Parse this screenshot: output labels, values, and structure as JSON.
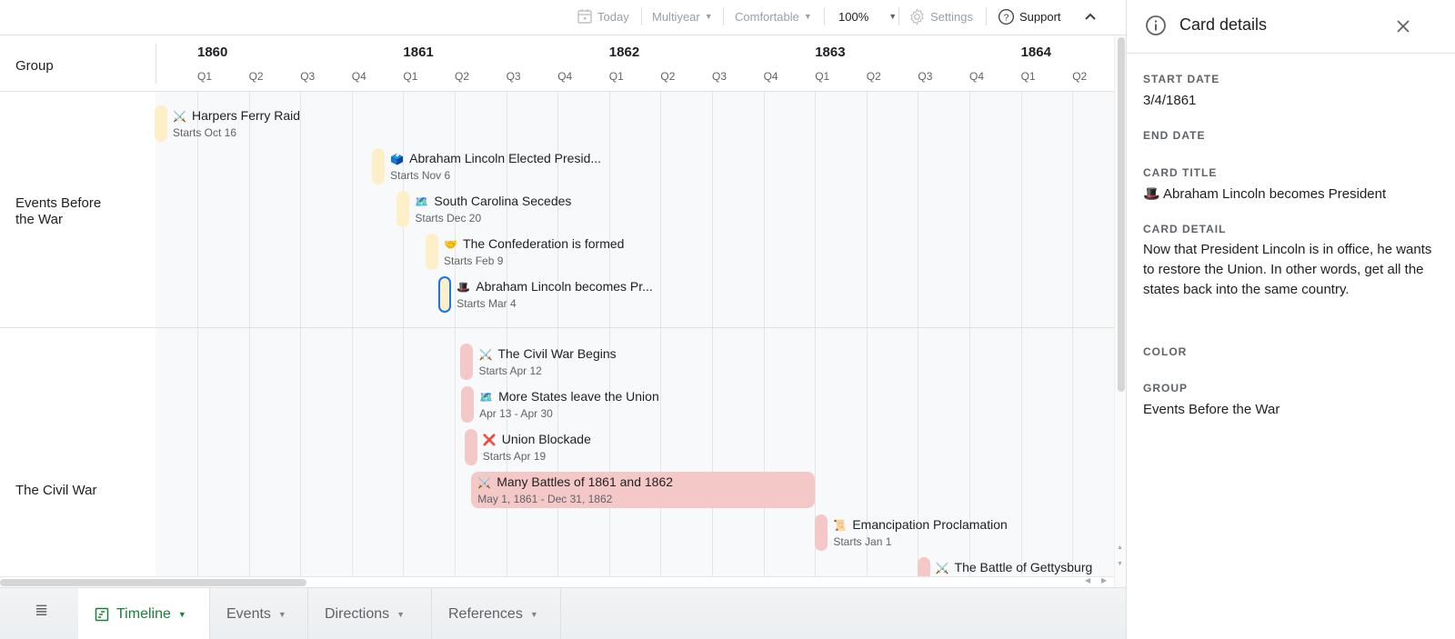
{
  "toolbar": {
    "today": "Today",
    "view": "Multiyear",
    "density": "Comfortable",
    "zoom": "100%",
    "settings": "Settings",
    "support": "Support"
  },
  "timeline": {
    "group_header": "Group",
    "years": [
      "1860",
      "1861",
      "1862",
      "1863",
      "1864"
    ],
    "quarters": [
      "Q1",
      "Q2",
      "Q3",
      "Q4",
      "Q1",
      "Q2",
      "Q3",
      "Q4",
      "Q1",
      "Q2",
      "Q3",
      "Q4",
      "Q1",
      "Q2",
      "Q3",
      "Q4",
      "Q1",
      "Q2"
    ],
    "groups": [
      {
        "label": "Events Before the War"
      },
      {
        "label": "The Civil War"
      }
    ],
    "colors": {
      "before_war": "#fdf0c8",
      "civil_war": "#f5c8c8",
      "selected_border": "#1a73e8"
    },
    "cards": [
      {
        "group": 0,
        "emoji": "⚔️",
        "title": "Harpers Ferry Raid",
        "sub": "Starts Oct 16",
        "start": "1859-10-16",
        "end": null
      },
      {
        "group": 0,
        "emoji": "🗳️",
        "title": "Abraham Lincoln Elected Presid...",
        "sub": "Starts Nov 6",
        "start": "1860-11-06",
        "end": null
      },
      {
        "group": 0,
        "emoji": "🗺️",
        "title": "South Carolina Secedes",
        "sub": "Starts Dec 20",
        "start": "1860-12-20",
        "end": null
      },
      {
        "group": 0,
        "emoji": "🤝",
        "title": "The Confederation is formed",
        "sub": "Starts Feb 9",
        "start": "1861-02-09",
        "end": null
      },
      {
        "group": 0,
        "emoji": "🎩",
        "title": "Abraham Lincoln becomes Pr...",
        "sub": "Starts Mar 4",
        "start": "1861-03-04",
        "end": null,
        "selected": true
      },
      {
        "group": 1,
        "emoji": "⚔️",
        "title": "The Civil War Begins",
        "sub": "Starts Apr 12",
        "start": "1861-04-12",
        "end": null
      },
      {
        "group": 1,
        "emoji": "🗺️",
        "title": "More States leave the Union",
        "sub": "Apr 13 - Apr 30",
        "start": "1861-04-13",
        "end": "1861-04-30"
      },
      {
        "group": 1,
        "emoji": "❌",
        "title": "Union Blockade",
        "sub": "Starts Apr 19",
        "start": "1861-04-19",
        "end": null
      },
      {
        "group": 1,
        "emoji": "⚔️",
        "title": "Many Battles of 1861 and 1862",
        "sub": "May 1, 1861 - Dec 31, 1862",
        "start": "1861-05-01",
        "end": "1862-12-31"
      },
      {
        "group": 1,
        "emoji": "📜",
        "title": "Emancipation Proclamation",
        "sub": "Starts Jan 1",
        "start": "1863-01-01",
        "end": null
      },
      {
        "group": 1,
        "emoji": "⚔️",
        "title": "The Battle of Gettysburg",
        "sub": "",
        "start": "1863-07-01",
        "end": null
      }
    ]
  },
  "tabs": [
    {
      "label": "Timeline",
      "active": true
    },
    {
      "label": "Events",
      "active": false
    },
    {
      "label": "Directions",
      "active": false
    },
    {
      "label": "References",
      "active": false
    }
  ],
  "details": {
    "title": "Card details",
    "start_date_label": "START DATE",
    "start_date": "3/4/1861",
    "end_date_label": "END DATE",
    "end_date": "",
    "card_title_label": "CARD TITLE",
    "card_title": "🎩 Abraham Lincoln becomes President",
    "card_detail_label": "CARD DETAIL",
    "card_detail": "Now that President Lincoln is in office, he wants to restore the Union. In other words, get all the states back into the same country.",
    "color_label": "COLOR",
    "color": "",
    "group_label": "GROUP",
    "group": "Events Before the War"
  }
}
